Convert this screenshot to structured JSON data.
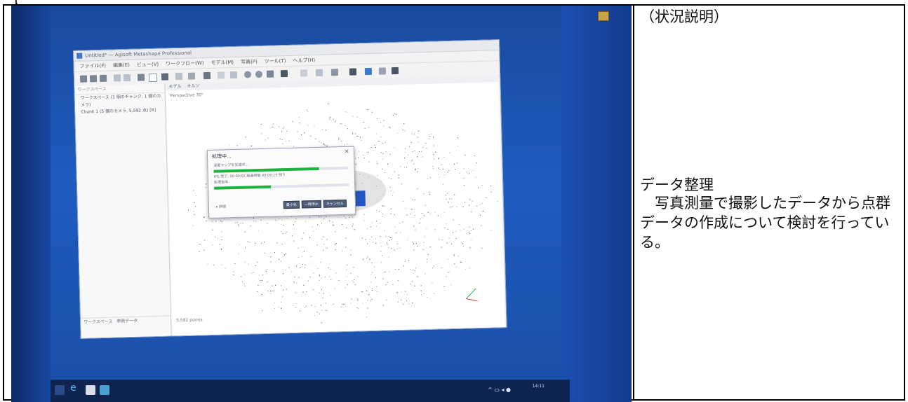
{
  "right_panel": {
    "status_heading": "（状況説明）",
    "section_title": "データ整理",
    "description": "　写真測量で撮影したデータから点群データの作成について検討を行っている。"
  },
  "photo": {
    "app": {
      "window_title": "Untitled* — Agisoft Metashape Professional",
      "menu": [
        "ファイル(F)",
        "編集(E)",
        "ビュー(V)",
        "ワークフロー(W)",
        "モデル(M)",
        "写真(P)",
        "ツール(T)",
        "ヘルプ(H)"
      ],
      "left_tree": [
        "ワークスペース (1 個のチャンク, 1 個のカメラ)",
        "Chunk 1 (5 個のカメラ, 5,592 点) [R]"
      ],
      "left_bottom_tabs": [
        "ワークスペース",
        "参照データ"
      ],
      "viewport_tabs": [
        "モデル",
        "オルソ"
      ],
      "viewport_label": "Perspective 30°",
      "status_points": "5,592 points",
      "dialog": {
        "title": "処理中...",
        "step": "深度マップを生成中...",
        "detail_line": "0% 完了, 00:00:02 経過時間 00:00:15 残り",
        "overall": "処理全体",
        "details_toggle": "詳細",
        "progress_step": 0.78,
        "progress_overall": 0.42,
        "buttons": [
          "最小化",
          "一時停止",
          "キャンセル"
        ]
      }
    },
    "taskbar_time": "14:11"
  }
}
